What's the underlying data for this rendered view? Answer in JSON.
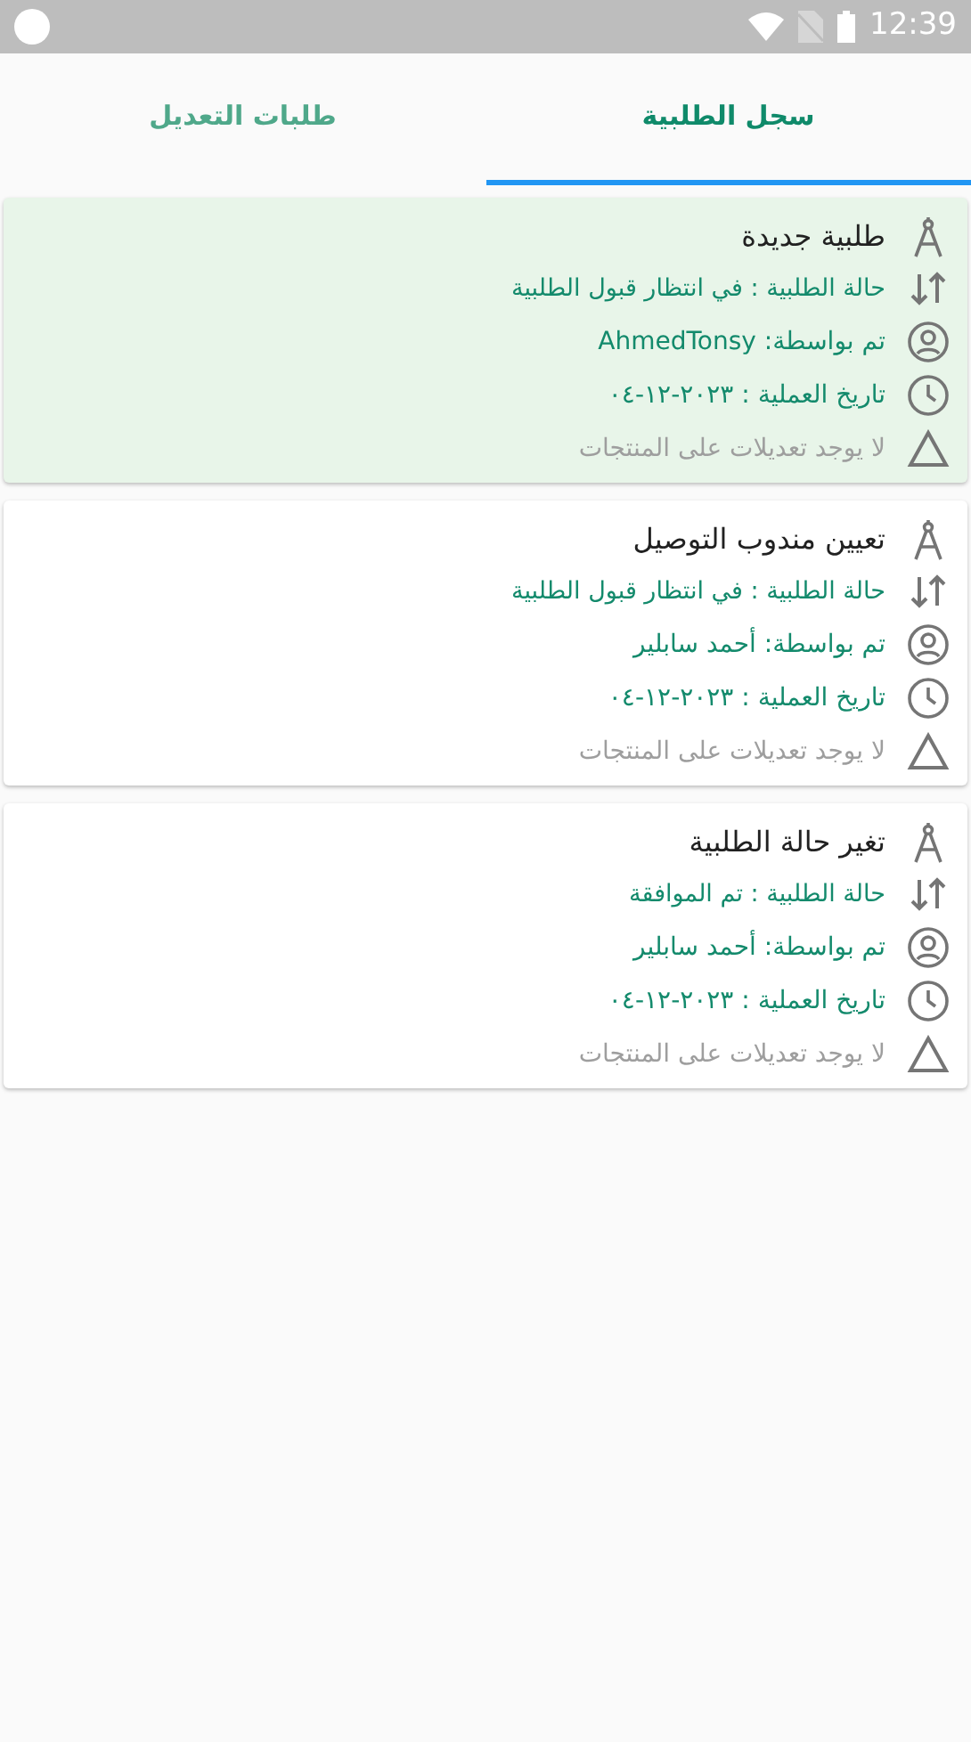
{
  "status_bar": {
    "time": "12:39"
  },
  "tabs": [
    {
      "label": "سجل الطلبية",
      "selected": true
    },
    {
      "label": "طلبات التعديل",
      "selected": false
    }
  ],
  "entries": [
    {
      "title": "طلبية جديدة",
      "highlighted": true,
      "status": "حالة الطلبية : في انتظار قبول الطلبية",
      "by": "تم بواسطة: AhmedTonsy",
      "date": "تاريخ العملية : ٢٠٢٣-١٢-٠٤",
      "note": "لا يوجد تعديلات على المنتجات"
    },
    {
      "title": "تعيين مندوب التوصيل",
      "highlighted": false,
      "status": "حالة الطلبية : في انتظار قبول الطلبية",
      "by": "تم بواسطة: أحمد سابلير",
      "date": "تاريخ العملية : ٢٠٢٣-١٢-٠٤",
      "note": "لا يوجد تعديلات على المنتجات"
    },
    {
      "title": "تغير حالة الطلبية",
      "highlighted": false,
      "status": "حالة الطلبية : تم الموافقة",
      "by": "تم بواسطة: أحمد سابلير",
      "date": "تاريخ العملية : ٢٠٢٣-١٢-٠٤",
      "note": "لا يوجد تعديلات على المنتجات"
    }
  ]
}
